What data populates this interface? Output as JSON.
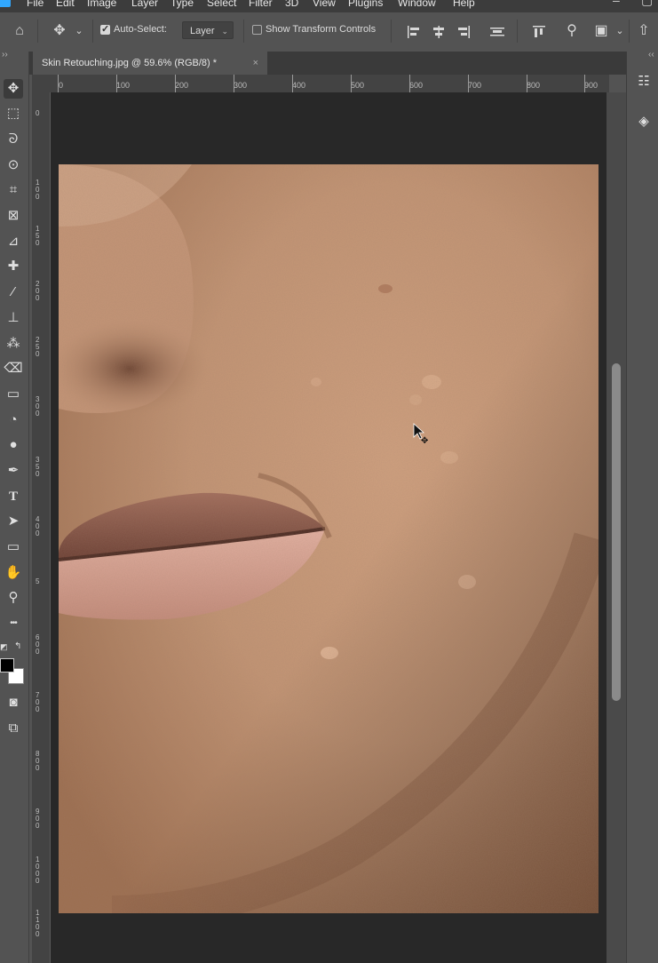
{
  "menu": {
    "items": [
      "File",
      "Edit",
      "Image",
      "Layer",
      "Type",
      "Select",
      "Filter",
      "3D",
      "View",
      "Plugins",
      "Window",
      "Help"
    ]
  },
  "options": {
    "auto_select_label": "Auto-Select:",
    "auto_select_checked": true,
    "target_value": "Layer",
    "show_transform_label": "Show Transform Controls",
    "show_transform_checked": false
  },
  "document": {
    "tab_title": "Skin Retouching.jpg @ 59.6% (RGB/8) *",
    "close_glyph": "×"
  },
  "ruler": {
    "top_ticks": [
      "0",
      "100",
      "200",
      "300",
      "400",
      "500",
      "600",
      "700",
      "800",
      "900"
    ],
    "left_ticks": [
      "0",
      "1\n0\n0",
      "1\n5\n0",
      "2\n0\n0",
      "2\n5\n0",
      "3\n0\n0",
      "3\n5\n0",
      "4\n0\n0",
      "5",
      "6\n0\n0",
      "7\n0\n0",
      "8\n0\n0",
      "9\n0\n0",
      "1\n0\n0\n0",
      "1\n1\n0\n0",
      "1\n2\n0\n0",
      "1\n3\n0\n0"
    ]
  },
  "icons": {
    "home": "⌂",
    "move": "✥",
    "chevron": "⌄",
    "marquee": "⬚",
    "lasso": "ᘐ",
    "quick_select": "⊙",
    "crop": "⌗",
    "frame": "⊠",
    "eyedropper": "⊿",
    "healing": "✚",
    "brush": "⁄",
    "stamp": "⊥",
    "history_brush": "⁂",
    "eraser": "⌫",
    "gradient": "▭",
    "blur": "◔",
    "dodge": "●",
    "pen": "✒",
    "type": "T",
    "path_select": "➤",
    "rectangle": "▭",
    "hand": "✋",
    "zoom": "⚲",
    "more": "•••",
    "quick_mask": "◙",
    "screen_mode": "⧉",
    "search": "⚲",
    "workspace": "▣",
    "share": "⇧",
    "adjust": "☷",
    "layers": "◈"
  },
  "colors": {
    "foreground": "#000000",
    "background": "#ffffff",
    "ui_bg": "#535353",
    "canvas_bg": "#282828"
  }
}
